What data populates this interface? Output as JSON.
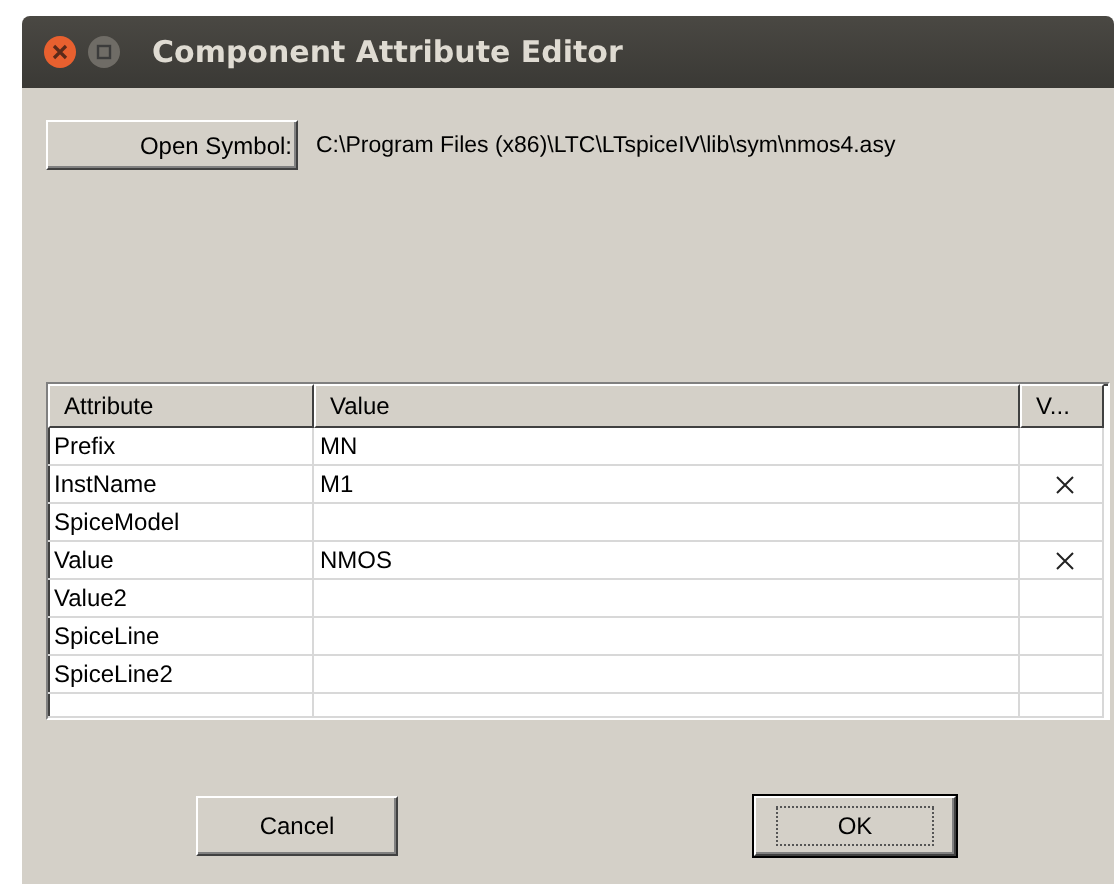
{
  "window": {
    "title": "Component Attribute Editor"
  },
  "open_symbol": {
    "label": "Open Symbol:",
    "path": "C:\\Program Files (x86)\\LTC\\LTspiceIV\\lib\\sym\\nmos4.asy"
  },
  "table": {
    "columns": [
      "Attribute",
      "Value",
      "V..."
    ],
    "rows": [
      {
        "attribute": "Prefix",
        "value": "MN",
        "visible": false
      },
      {
        "attribute": "InstName",
        "value": "M1",
        "visible": true
      },
      {
        "attribute": "SpiceModel",
        "visible": false
      },
      {
        "attribute": "Value",
        "value": "NMOS",
        "visible": true
      },
      {
        "attribute": "Value2",
        "visible": false
      },
      {
        "attribute": "SpiceLine",
        "visible": false
      },
      {
        "attribute": "SpiceLine2",
        "visible": false
      }
    ]
  },
  "buttons": [
    {
      "label": "Cancel",
      "default": false
    },
    {
      "label": "OK",
      "default": true
    }
  ]
}
